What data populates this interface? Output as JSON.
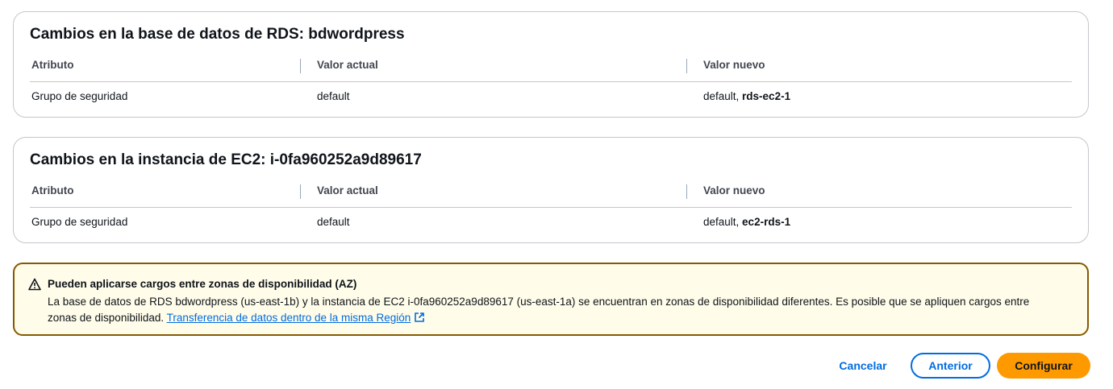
{
  "rds_card": {
    "title": "Cambios en la base de datos de RDS: bdwordpress",
    "headers": {
      "attribute": "Atributo",
      "current": "Valor actual",
      "new": "Valor nuevo"
    },
    "row": {
      "attribute": "Grupo de seguridad",
      "current": "default",
      "new_prefix": "default, ",
      "new_bold": "rds-ec2-1"
    }
  },
  "ec2_card": {
    "title": "Cambios en la instancia de EC2: i-0fa960252a9d89617",
    "headers": {
      "attribute": "Atributo",
      "current": "Valor actual",
      "new": "Valor nuevo"
    },
    "row": {
      "attribute": "Grupo de seguridad",
      "current": "default",
      "new_prefix": "default, ",
      "new_bold": "ec2-rds-1"
    }
  },
  "alert": {
    "icon": "warning-icon",
    "title": "Pueden aplicarse cargos entre zonas de disponibilidad (AZ)",
    "body": "La base de datos de RDS bdwordpress (us-east-1b) y la instancia de EC2 i-0fa960252a9d89617 (us-east-1a) se encuentran en zonas de disponibilidad diferentes. Es posible que se apliquen cargos entre zonas de disponibilidad. ",
    "link_label": "Transferencia de datos dentro de la misma Región",
    "link_icon": "external-link-icon",
    "color_border": "#855900",
    "color_background": "#fffce9"
  },
  "actions": {
    "cancel_label": "Cancelar",
    "previous_label": "Anterior",
    "configure_label": "Configurar",
    "primary_color": "#ff9900",
    "link_color": "#006ce0"
  }
}
